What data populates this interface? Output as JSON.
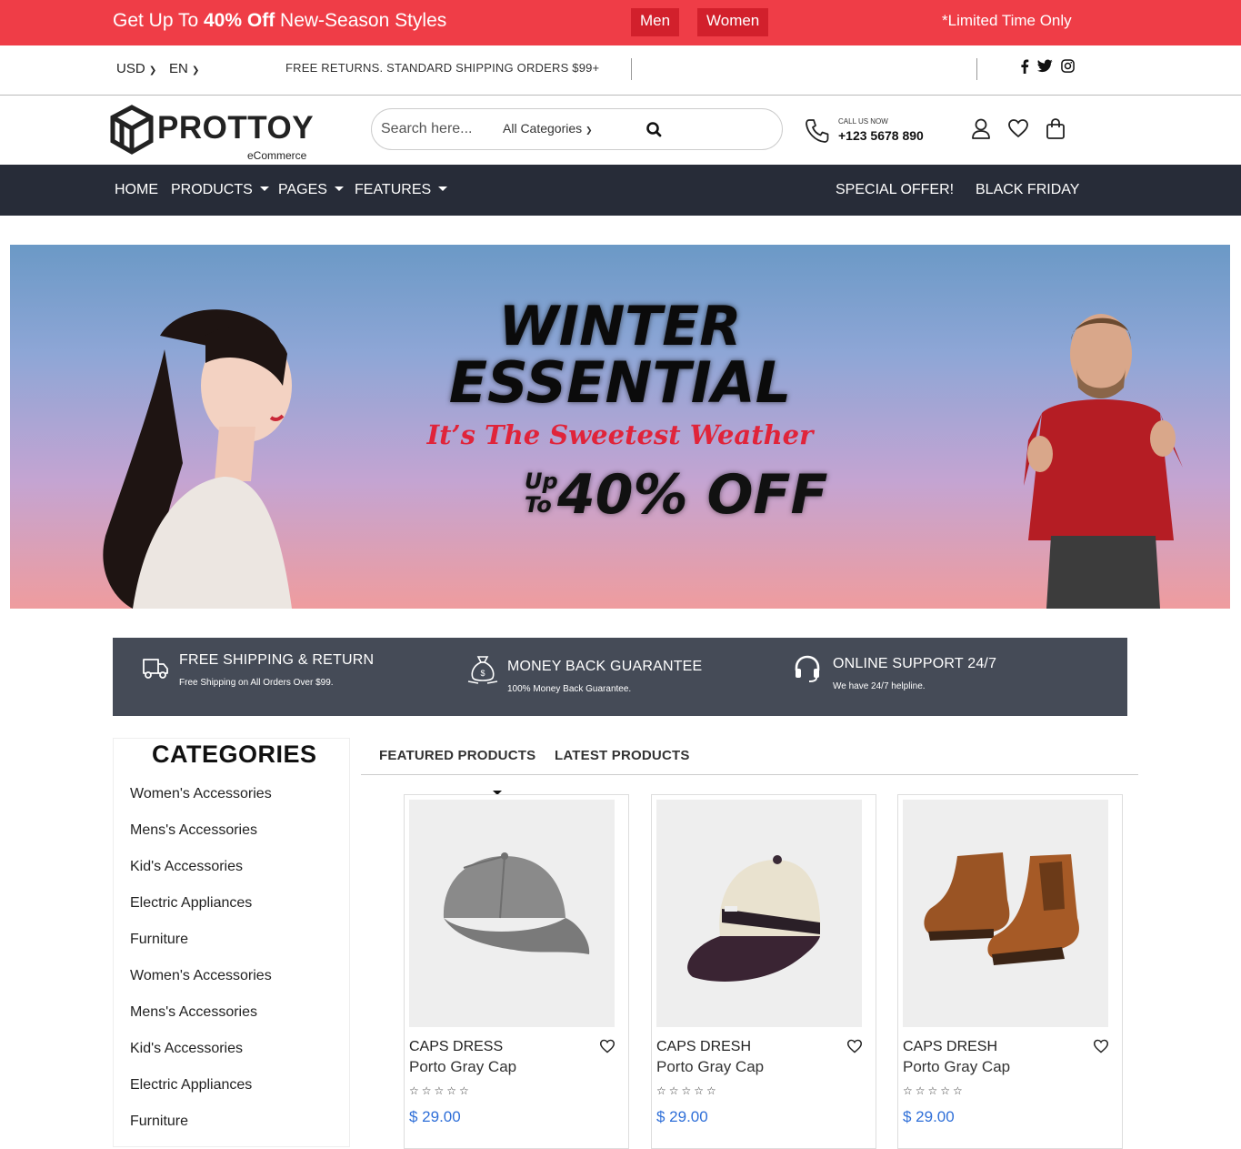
{
  "promo": {
    "prefix": "Get Up To ",
    "bold": "40% Off",
    "suffix": " New-Season Styles",
    "men": "Men",
    "women": "Women",
    "limited": "*Limited Time Only"
  },
  "util": {
    "currency": "USD",
    "language": "EN",
    "shipping": "FREE RETURNS. STANDARD SHIPPING ORDERS $99+"
  },
  "header": {
    "brand": "PROTTOY",
    "brand_sub": "eCommerce",
    "search_placeholder": "Search here...",
    "category": "All Categories",
    "call_label": "CALL US NOW",
    "phone": "+123 5678 890"
  },
  "nav": {
    "items": [
      "HOME",
      "PRODUCTS",
      "PAGES",
      "FEATURES"
    ],
    "special": "SPECIAL OFFER!",
    "black_friday": "BLACK FRIDAY"
  },
  "banner": {
    "line1": "WINTER",
    "line2": "ESSENTIAL",
    "tagline": "It’s The Sweetest Weather",
    "up": "Up",
    "to": "To",
    "offer": "40% OFF"
  },
  "features": [
    {
      "title": "FREE SHIPPING & RETURN",
      "sub": "Free Shipping on All Orders Over $99.",
      "icon": "truck-icon"
    },
    {
      "title": "MONEY BACK GUARANTEE",
      "sub": "100% Money Back Guarantee.",
      "icon": "money-bag-icon"
    },
    {
      "title": "ONLINE SUPPORT 24/7",
      "sub": "We have 24/7 helpline.",
      "icon": "headset-icon"
    }
  ],
  "categories": {
    "title": "CATEGORIES",
    "items": [
      "Women's Accessories",
      "Mens's Accessories",
      "Kid's Accessories",
      "Electric Appliances",
      "Furniture",
      "Women's Accessories",
      "Mens's Accessories",
      "Kid's Accessories",
      "Electric Appliances",
      "Furniture"
    ]
  },
  "tabs": {
    "featured": "FEATURED PRODUCTS",
    "latest": "LATEST PRODUCTS"
  },
  "products": [
    {
      "category": "CAPS DRESS",
      "name": "Porto Gray Cap",
      "price": "$ 29.00",
      "rating": "☆☆☆☆☆"
    },
    {
      "category": "CAPS DRESH",
      "name": "Porto Gray Cap",
      "price": "$ 29.00",
      "rating": "☆☆☆☆☆"
    },
    {
      "category": "CAPS DRESH",
      "name": "Porto Gray Cap",
      "price": "$ 29.00",
      "rating": "☆☆☆☆☆"
    }
  ],
  "colors": {
    "promo": "#ef3d47",
    "nav": "#272c38",
    "features": "#454b57",
    "price": "#2f6fd8"
  }
}
